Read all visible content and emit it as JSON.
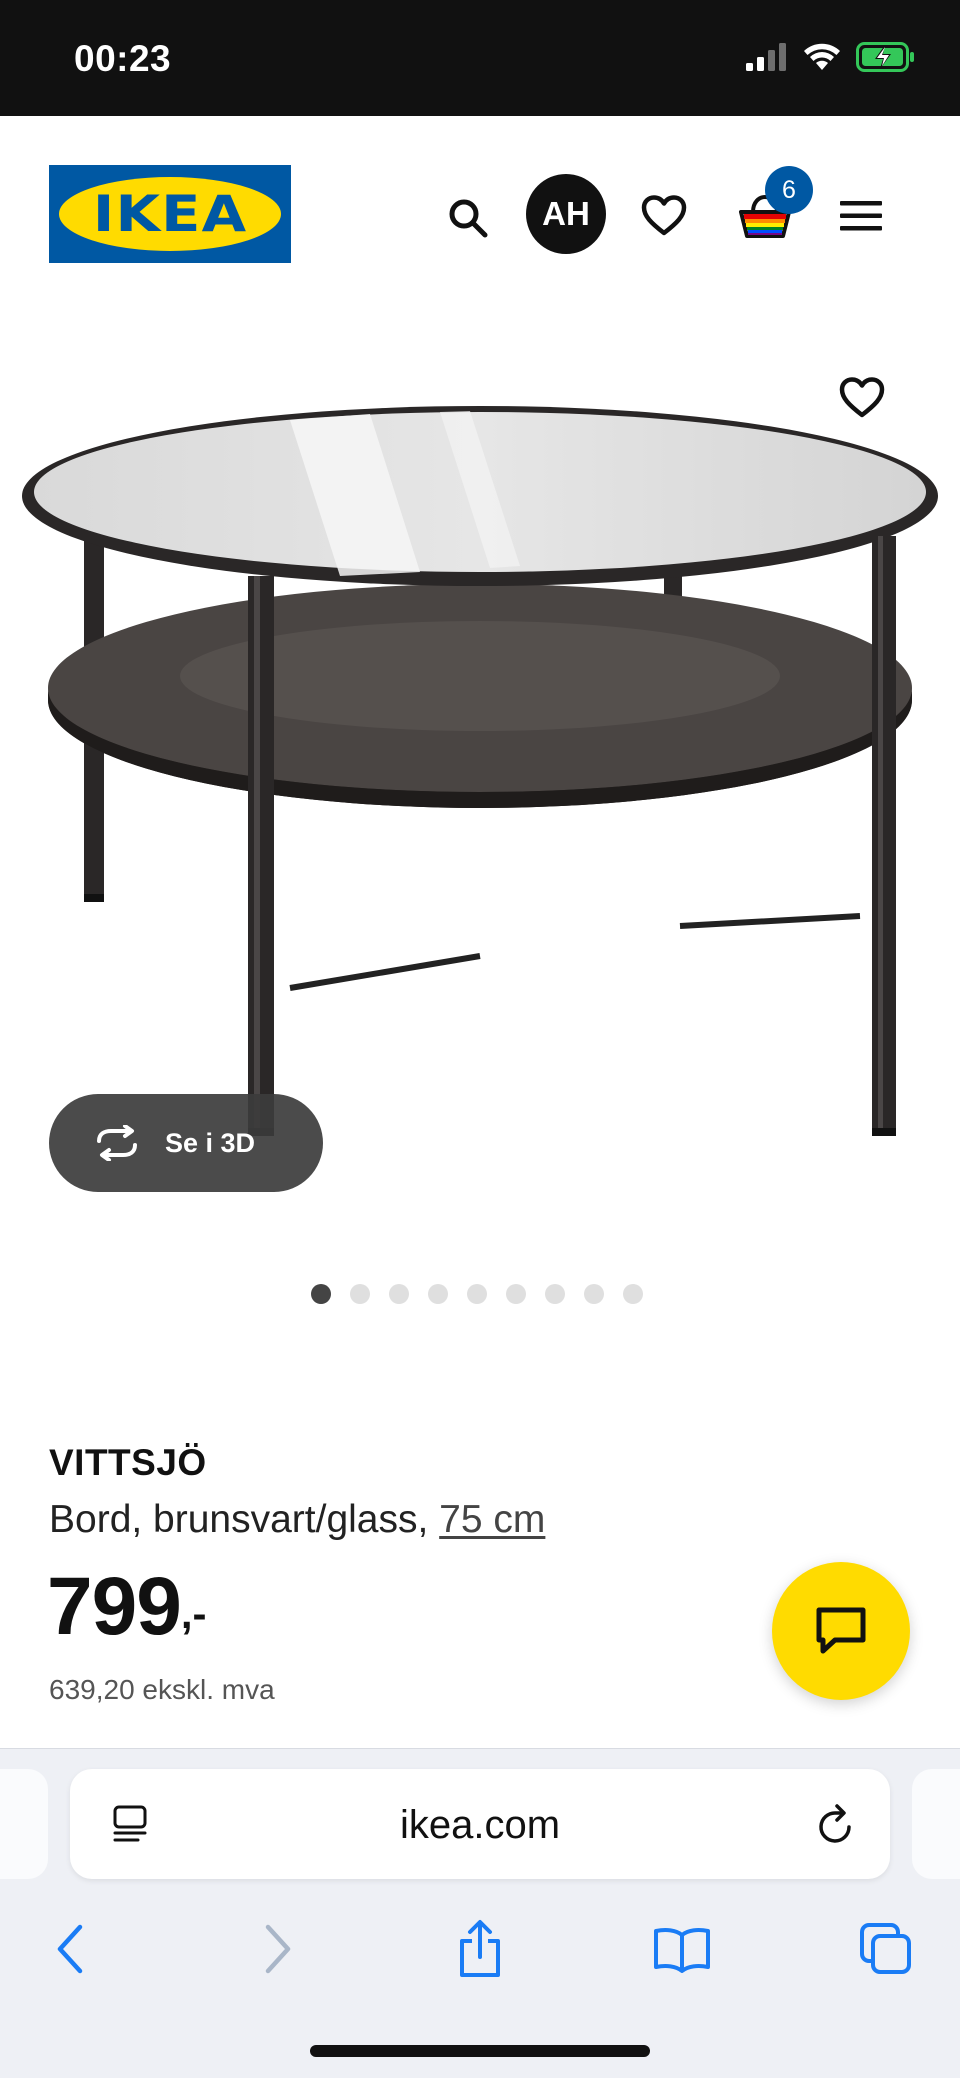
{
  "status_bar": {
    "time": "00:23"
  },
  "header": {
    "logo_text": "IKEA",
    "avatar_initials": "AH",
    "cart_count": "6"
  },
  "product_image": {
    "view3d_label": "Se i 3D",
    "dots_total": 9,
    "active_dot": 0
  },
  "product": {
    "name": "VITTSJÖ",
    "description": "Bord, brunsvart/glass, ",
    "size": "75 cm",
    "price": "799",
    "price_suffix": ",-",
    "price_ex_vat": "639,20 ekskl. mva"
  },
  "browser": {
    "url": "ikea.com"
  },
  "colors": {
    "ikea_blue": "#0058a3",
    "ikea_yellow": "#ffdb00",
    "safari_blue": "#1a7cf5"
  }
}
